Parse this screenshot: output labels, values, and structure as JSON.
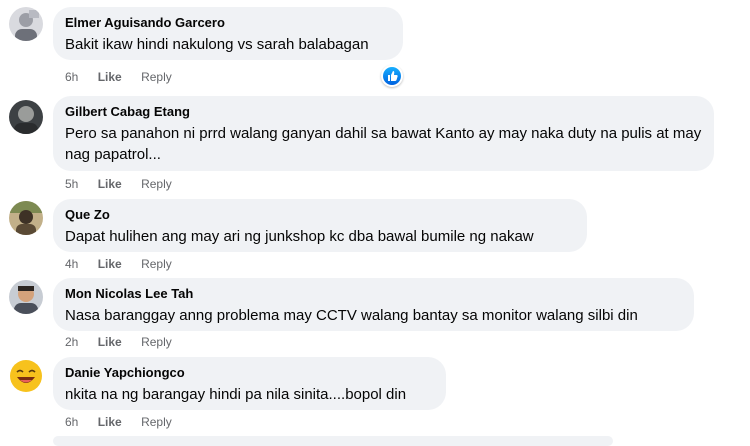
{
  "comments": [
    {
      "author": "Elmer Aguisando Garcero",
      "text": "Bakit ikaw hindi nakulong vs sarah balabagan",
      "time": "6h",
      "like": "Like",
      "reply": "Reply",
      "reaction": "like-icon"
    },
    {
      "author": "Gilbert Cabag Etang",
      "text": "Pero sa panahon ni prrd walang ganyan dahil sa bawat Kanto ay may naka duty na pulis at may nag papatrol...",
      "time": "5h",
      "like": "Like",
      "reply": "Reply"
    },
    {
      "author": "Que Zo",
      "text": "Dapat hulihen ang may ari ng junkshop kc dba bawal bumile ng nakaw",
      "time": "4h",
      "like": "Like",
      "reply": "Reply"
    },
    {
      "author": "Mon Nicolas Lee Tah",
      "text": "Nasa baranggay anng problema may CCTV walang bantay sa monitor walang silbi din",
      "time": "2h",
      "like": "Like",
      "reply": "Reply"
    },
    {
      "author": "Danie Yapchiongco",
      "text": "nkita na ng barangay hindi pa nila sinita....bopol din",
      "time": "6h",
      "like": "Like",
      "reply": "Reply"
    }
  ],
  "colors": {
    "bubble": "#f0f2f5",
    "meta": "#65676b",
    "like_blue": "#1877f2"
  }
}
